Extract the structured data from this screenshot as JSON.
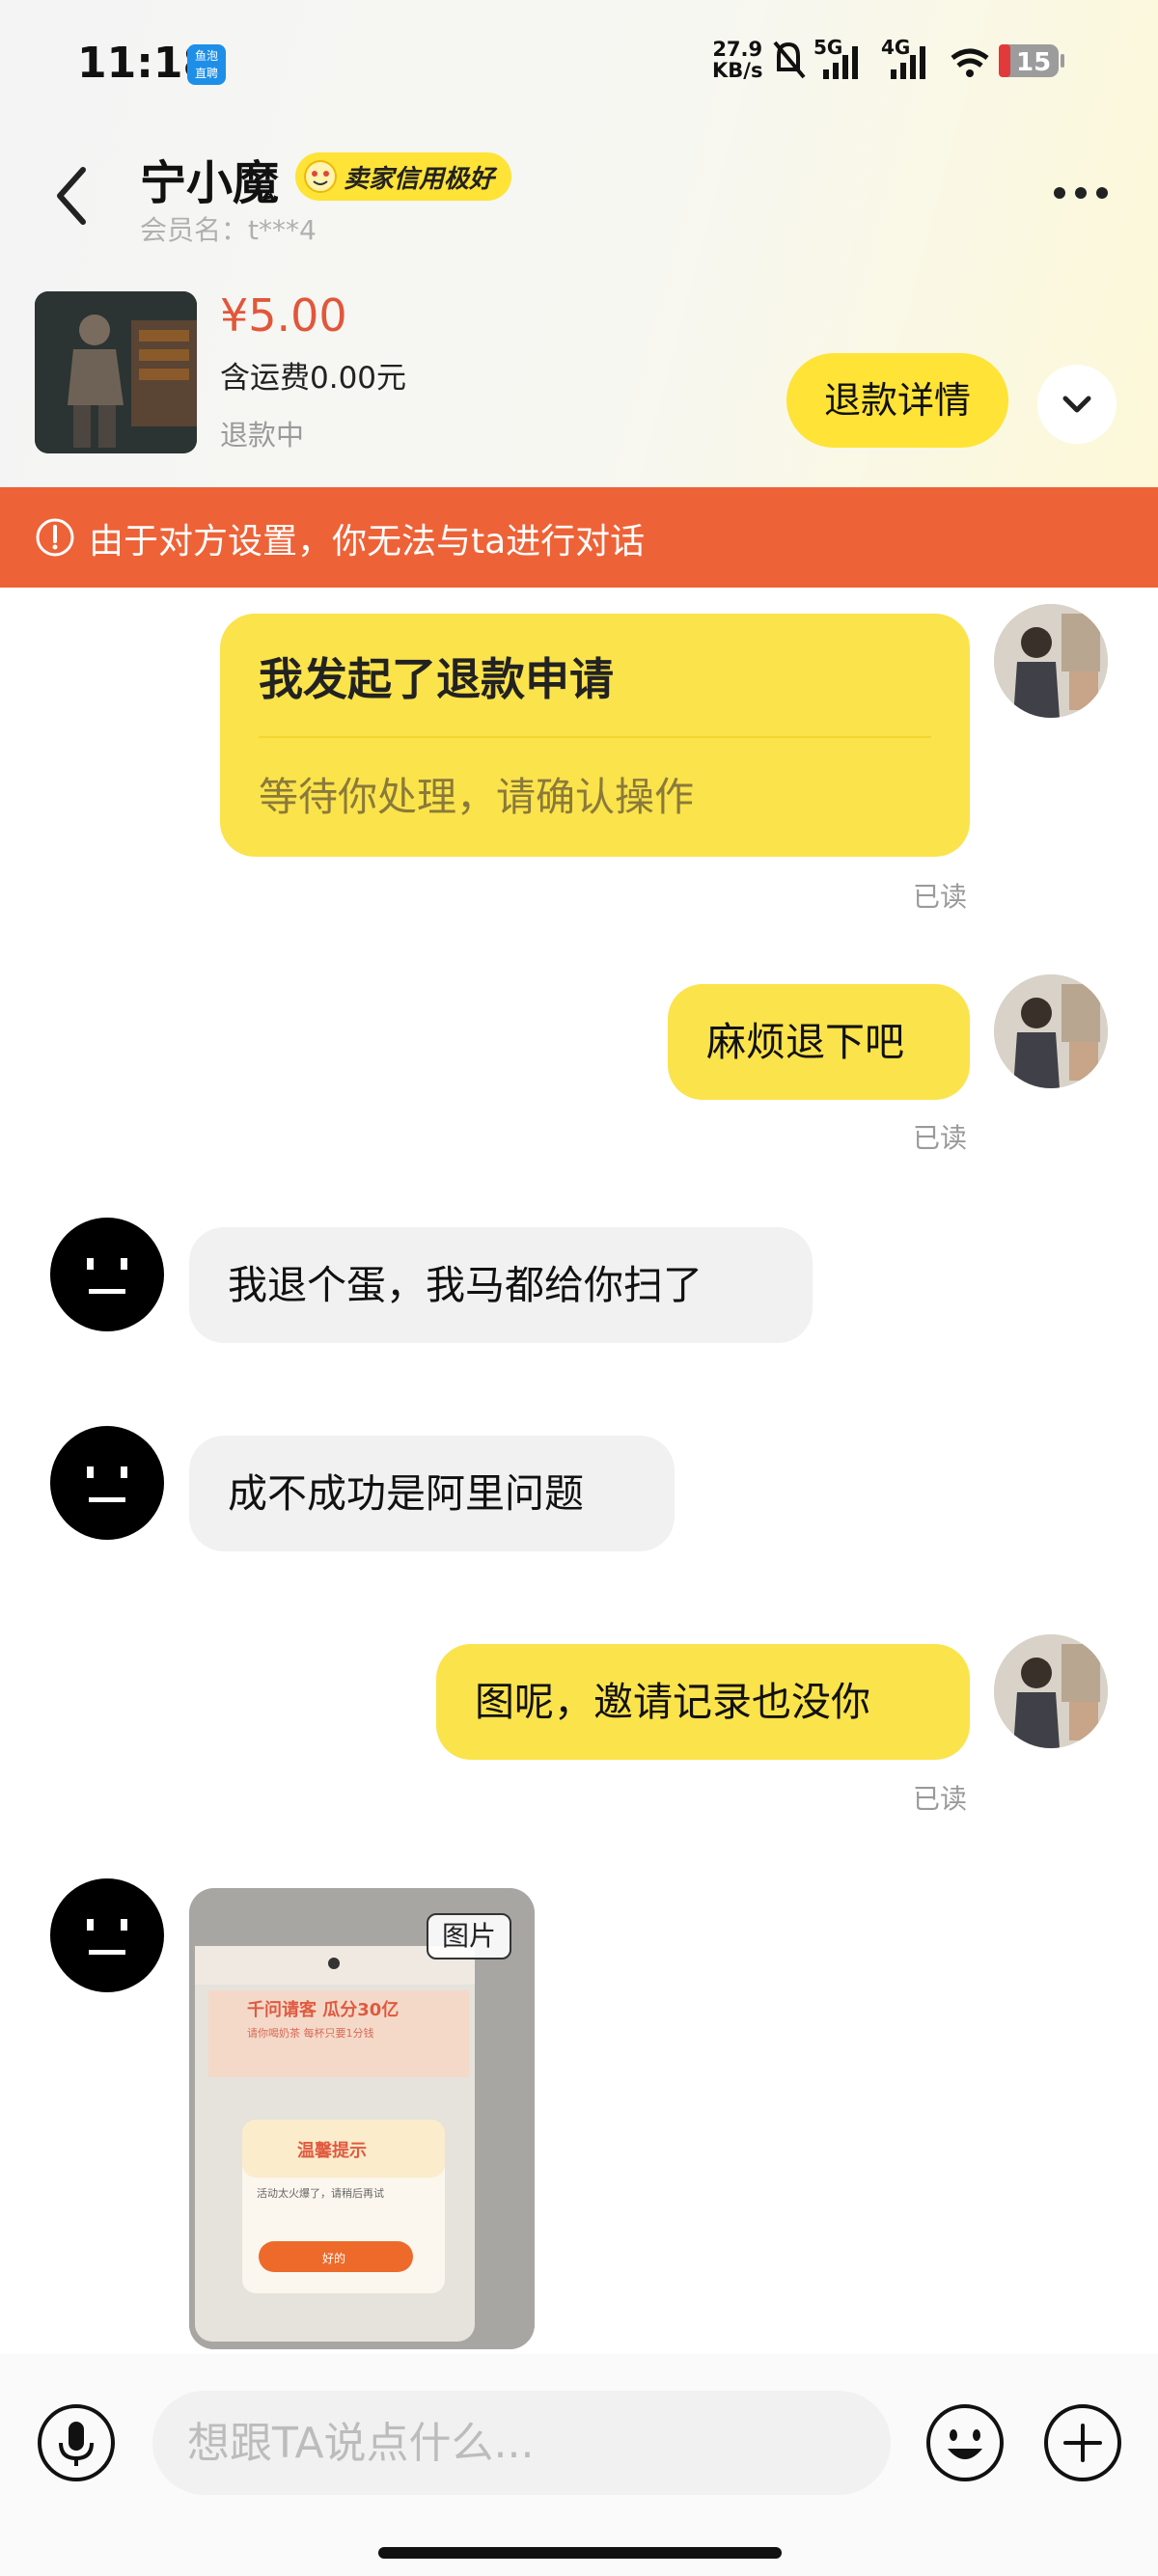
{
  "status_bar": {
    "time": "11:18",
    "app_badge": [
      "鱼泡",
      "直聘"
    ],
    "net_speed_value": "27.9",
    "net_speed_unit": "KB/s",
    "signal_a": "5G",
    "signal_b": "4G",
    "battery": "15"
  },
  "header": {
    "name": "宁小魔",
    "credit_badge": "卖家信用极好",
    "member_label": "会员名：t***4"
  },
  "product": {
    "price": "¥5.00",
    "shipping": "含运费0.00元",
    "status": "退款中",
    "refund_button": "退款详情"
  },
  "banner": {
    "text": "由于对方设置，你无法与ta进行对话"
  },
  "chat": {
    "refund_card": {
      "title": "我发起了退款申请",
      "subtitle": "等待你处理，请确认操作"
    },
    "read_label": "已读",
    "messages": [
      {
        "from": "me",
        "text": "麻烦退下吧"
      },
      {
        "from": "other",
        "text": "我退个蛋，我马都给你扫了"
      },
      {
        "from": "other",
        "text": "成不成功是阿里问题"
      },
      {
        "from": "me",
        "text": "图呢，邀请记录也没你"
      }
    ],
    "image_tag": "图片",
    "image_content": {
      "headline": "千问请客 瓜分30亿",
      "sub": "请你喝奶茶 每杯只要1分钱",
      "dialog_title": "温馨提示",
      "dialog_text": "活动太火爆了，请稍后再试",
      "dialog_button": "好的"
    }
  },
  "input": {
    "placeholder": "想跟TA说点什么..."
  },
  "colors": {
    "accent_yellow": "#fbe34b",
    "banner_orange": "#ee6237",
    "price_red": "#e2563a"
  },
  "icons": [
    "back-arrow-icon",
    "more-dots-icon",
    "chevron-down-icon",
    "info-circle-icon",
    "microphone-icon",
    "emoji-icon",
    "plus-icon"
  ]
}
